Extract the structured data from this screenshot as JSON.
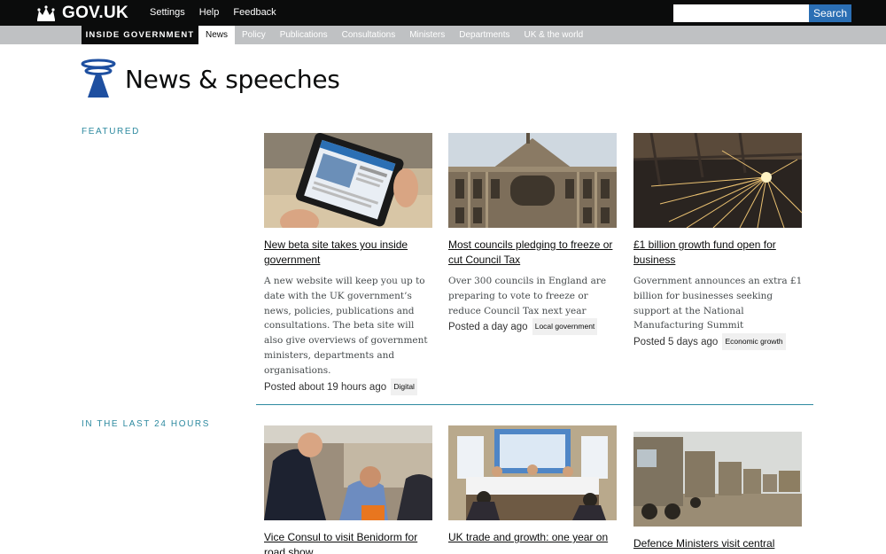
{
  "header": {
    "logo_text": "GOV.UK",
    "links": [
      "Settings",
      "Help",
      "Feedback"
    ],
    "search_placeholder": "",
    "search_button": "Search"
  },
  "subnav": {
    "brand": "INSIDE GOVERNMENT",
    "items": [
      "News",
      "Policy",
      "Publications",
      "Consultations",
      "Ministers",
      "Departments",
      "UK & the world"
    ],
    "active": "News"
  },
  "page": {
    "title": "News & speeches"
  },
  "featured": {
    "label": "FEATURED",
    "cards": [
      {
        "image": "tablet-photo",
        "title": "New beta site takes you inside government",
        "summary": "A new website will keep you up to date with the UK government’s news, policies, publications and consultations. The beta site will also give overviews of government ministers, departments and organisations.",
        "meta": "Posted about 19 hours ago",
        "tag": "Digital"
      },
      {
        "image": "council-house-photo",
        "title": "Most councils pledging to freeze or cut Council Tax",
        "summary": "Over 300 councils in England are preparing to vote to freeze or reduce Council Tax next year",
        "meta": "Posted a day ago",
        "tag": "Local government"
      },
      {
        "image": "sparks-factory-photo",
        "title": "£1 billion growth fund open for business",
        "summary": "Government announces an extra £1 billion for businesses seeking support at the National Manufacturing Summit",
        "meta": "Posted 5 days ago",
        "tag": "Economic growth"
      }
    ]
  },
  "recent": {
    "label": "IN THE LAST 24 HOURS",
    "cards": [
      {
        "image": "consul-meeting-photo",
        "title": "Vice Consul to visit Benidorm for road show"
      },
      {
        "image": "press-conference-photo",
        "title": "UK trade and growth: one year on"
      },
      {
        "image": "military-trucks-photo",
        "title": "Defence Ministers visit central Asian countries"
      }
    ]
  }
}
